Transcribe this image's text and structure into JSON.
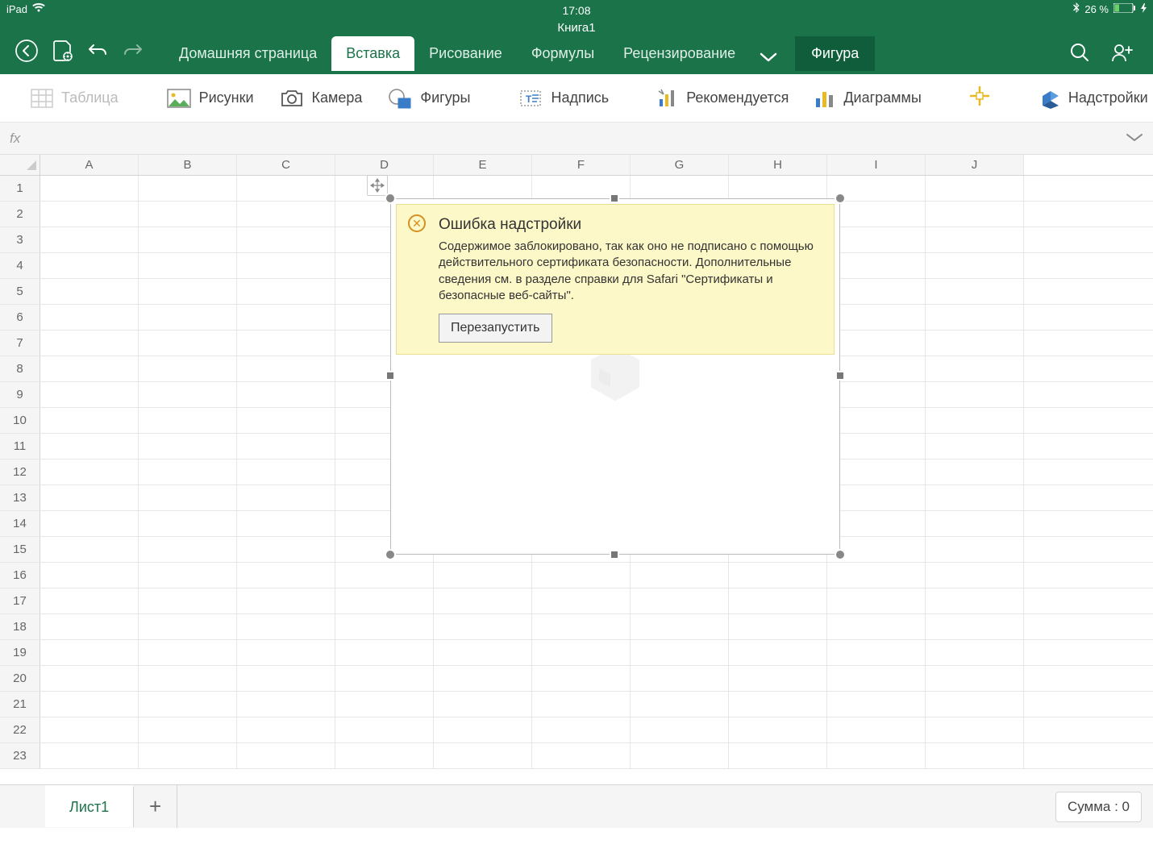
{
  "status": {
    "device": "iPad",
    "time": "17:08",
    "battery": "26 %"
  },
  "header": {
    "document_title": "Книга1",
    "tabs": [
      "Домашняя страница",
      "Вставка",
      "Рисование",
      "Формулы",
      "Рецензирование"
    ],
    "active_tab_index": 1,
    "context_tab": "Фигура"
  },
  "ribbon": {
    "table": "Таблица",
    "pictures": "Рисунки",
    "camera": "Камера",
    "shapes": "Фигуры",
    "textbox": "Надпись",
    "recommended": "Рекомендуется",
    "charts": "Диаграммы",
    "addins": "Надстройки"
  },
  "formula_bar": {
    "fx": "fx"
  },
  "grid": {
    "columns": [
      "A",
      "B",
      "C",
      "D",
      "E",
      "F",
      "G",
      "H",
      "I",
      "J"
    ],
    "rows": [
      "1",
      "2",
      "3",
      "4",
      "5",
      "6",
      "7",
      "8",
      "9",
      "10",
      "11",
      "12",
      "13",
      "14",
      "15",
      "16",
      "17",
      "18",
      "19",
      "20",
      "21",
      "22",
      "23"
    ]
  },
  "error": {
    "title": "Ошибка надстройки",
    "body": "Содержимое заблокировано, так как оно не подписано с помощью действительного сертификата безопасности. Дополнительные сведения см. в разделе справки для Safari \"Сертификаты и безопасные веб-сайты\".",
    "button": "Перезапустить"
  },
  "footer": {
    "sheet": "Лист1",
    "sum": "Сумма : 0"
  }
}
